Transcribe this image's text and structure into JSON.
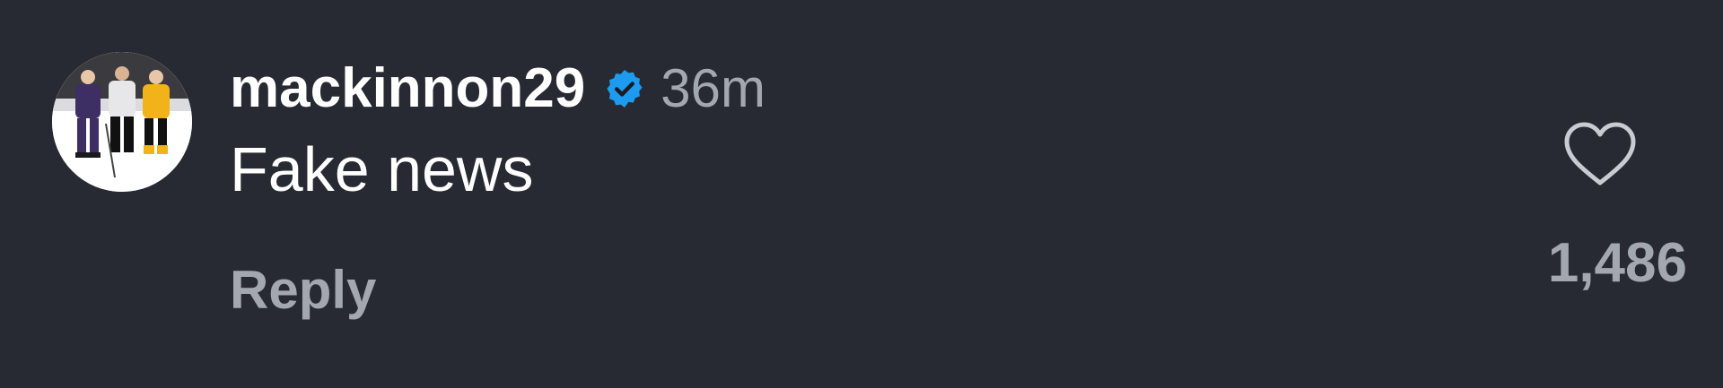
{
  "comment": {
    "username": "mackinnon29",
    "verified_icon": "verified-badge-icon",
    "timestamp": "36m",
    "text": "Fake news",
    "reply_label": "Reply",
    "like_icon": "heart-outline-icon",
    "like_count": "1,486"
  },
  "colors": {
    "background": "#272a32",
    "primary_text": "#ffffff",
    "secondary_text": "#a3a7b0",
    "verified_blue": "#1d9bf0"
  }
}
